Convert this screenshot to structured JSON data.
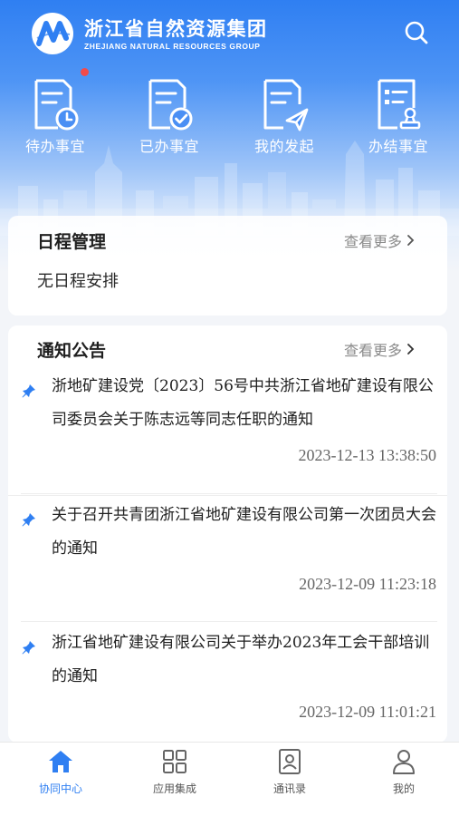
{
  "brand": {
    "name_cn": "浙江省自然资源集团",
    "name_en": "ZHEJIANG NATURAL RESOURCES GROUP"
  },
  "quick_actions": [
    {
      "label": "待办事宜",
      "icon": "pending-doc-clock-icon",
      "badge": true
    },
    {
      "label": "已办事宜",
      "icon": "done-doc-check-icon"
    },
    {
      "label": "我的发起",
      "icon": "sent-doc-plane-icon"
    },
    {
      "label": "办结事宜",
      "icon": "finished-doc-stamp-icon"
    }
  ],
  "schedule": {
    "title": "日程管理",
    "more": "查看更多",
    "empty": "无日程安排"
  },
  "notices": {
    "title": "通知公告",
    "more": "查看更多",
    "items": [
      {
        "title": "浙地矿建设党〔2023〕56号中共浙江省地矿建设有限公司委员会关于陈志远等同志任职的通知",
        "time": "2023-12-13 13:38:50"
      },
      {
        "title": "关于召开共青团浙江省地矿建设有限公司第一次团员大会的通知",
        "time": "2023-12-09 11:23:18"
      },
      {
        "title": "浙江省地矿建设有限公司关于举办2023年工会干部培训的通知",
        "time": "2023-12-09 11:01:21"
      }
    ]
  },
  "tabs": [
    {
      "label": "协同中心",
      "icon": "home-icon",
      "active": true
    },
    {
      "label": "应用集成",
      "icon": "apps-grid-icon"
    },
    {
      "label": "通讯录",
      "icon": "contacts-book-icon"
    },
    {
      "label": "我的",
      "icon": "profile-icon"
    }
  ],
  "colors": {
    "primary": "#2f7ff2",
    "badge": "#f24b4b",
    "pin": "#2f7ff2"
  }
}
